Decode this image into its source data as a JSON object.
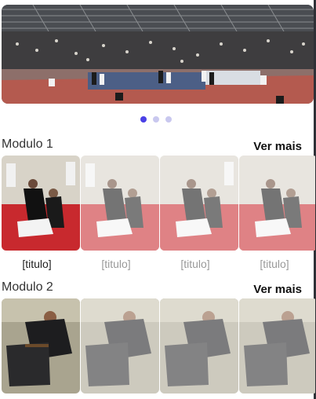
{
  "carousel": {
    "image": "gym-tournament-photo",
    "page_count": 3,
    "active_index": 0
  },
  "modules": [
    {
      "title": "Modulo 1",
      "see_more": "Ver mais",
      "cards": [
        {
          "caption": "[titulo]",
          "image": "judo-takedown-photo",
          "active": true
        },
        {
          "caption": "[titulo]",
          "image": "judo-takedown-photo",
          "active": false
        },
        {
          "caption": "[titulo]",
          "image": "judo-takedown-photo",
          "active": false
        },
        {
          "caption": "[titulo]",
          "image": "judo-takedown-photo",
          "active": false
        }
      ]
    },
    {
      "title": "Modulo 2",
      "see_more": "Ver mais",
      "cards": [
        {
          "image": "jiujitsu-grappling-photo",
          "active": true
        },
        {
          "image": "jiujitsu-grappling-photo",
          "active": false
        },
        {
          "image": "jiujitsu-grappling-photo",
          "active": false
        },
        {
          "image": "jiujitsu-grappling-photo",
          "active": false
        }
      ]
    }
  ],
  "colors": {
    "active_dot": "#4a40e6",
    "inactive_dot": "#c9c8ef"
  }
}
